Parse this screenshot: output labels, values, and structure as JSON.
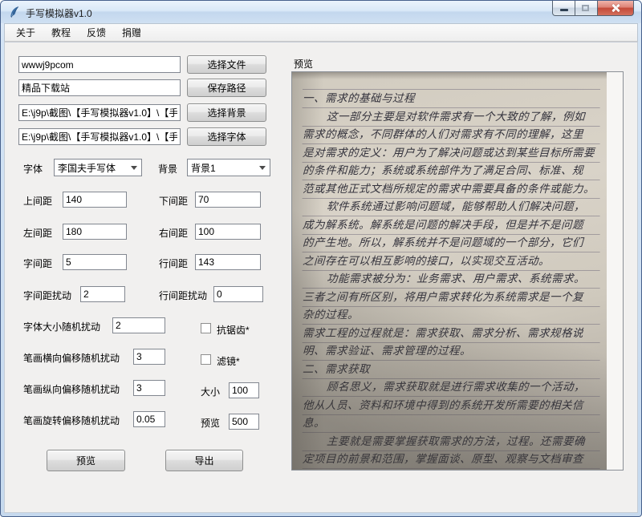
{
  "window": {
    "title": "手写模拟器v1.0"
  },
  "menu": {
    "about": "关于",
    "tutorial": "教程",
    "feedback": "反馈",
    "donate": "捐赠"
  },
  "file_section": {
    "text_value": "wwwj9pcom",
    "save_value": "精品下载站",
    "background_path": "E:\\j9p\\截图\\【手写模拟器v1.0】\\【手",
    "font_path": "E:\\j9p\\截图\\【手写模拟器v1.0】\\【手",
    "choose_file": "选择文件",
    "save_path": "保存路径",
    "choose_background": "选择背景",
    "choose_font": "选择字体"
  },
  "selectors": {
    "font_label": "字体",
    "font_value": "李国夫手写体",
    "background_label": "背景",
    "background_value": "背景1"
  },
  "spacing": {
    "top": {
      "label": "上间距",
      "value": "140"
    },
    "bottom": {
      "label": "下间距",
      "value": "70"
    },
    "left": {
      "label": "左间距",
      "value": "180"
    },
    "right": {
      "label": "右间距",
      "value": "100"
    },
    "char": {
      "label": "字间距",
      "value": "5"
    },
    "line": {
      "label": "行间距",
      "value": "143"
    },
    "char_jitter": {
      "label": "字间距扰动",
      "value": "2"
    },
    "line_jitter": {
      "label": "行间距扰动",
      "value": "0"
    }
  },
  "perturb": {
    "font_size": {
      "label": "字体大小随机扰动",
      "value": "2"
    },
    "stroke_h": {
      "label": "笔画横向偏移随机扰动",
      "value": "3"
    },
    "stroke_v": {
      "label": "笔画纵向偏移随机扰动",
      "value": "3"
    },
    "stroke_rot": {
      "label": "笔画旋转偏移随机扰动",
      "value": "0.05"
    }
  },
  "options": {
    "antialias": {
      "label": "抗锯齿*",
      "checked": false
    },
    "filter": {
      "label": "滤镜*",
      "checked": false
    },
    "size": {
      "label": "大小",
      "value": "100"
    },
    "preview_size": {
      "label": "预览",
      "value": "500"
    }
  },
  "actions": {
    "preview": "预览",
    "export": "导出"
  },
  "preview": {
    "label": "预览",
    "lines": [
      {
        "t": "一、需求的基础与过程",
        "ind": false
      },
      {
        "t": "这一部分主要是对软件需求有一个大致的了解，例如",
        "ind": true
      },
      {
        "t": "需求的概念，不同群体的人们对需求有不同的理解，这里",
        "ind": false
      },
      {
        "t": "是对需求的定义：用户为了解决问题或达到某些目标所需要",
        "ind": false
      },
      {
        "t": "的条件和能力；系统或系统部件为了满足合同、标准、规",
        "ind": false
      },
      {
        "t": "范或其他正式文档所规定的需求中需要具备的条件或能力。",
        "ind": false
      },
      {
        "t": "软件系统通过影响问题域，能够帮助人们解决问题，",
        "ind": true
      },
      {
        "t": "成为解系统。解系统是问题的解决手段，但是并不是问题",
        "ind": false
      },
      {
        "t": "的产生地。所以，解系统并不是问题域的一个部分，它们",
        "ind": false
      },
      {
        "t": "之间存在可以相互影响的接口，以实现交互活动。",
        "ind": false
      },
      {
        "t": "功能需求被分为：业务需求、用户需求、系统需求。",
        "ind": true
      },
      {
        "t": "三者之间有所区别，将用户需求转化为系统需求是一个复",
        "ind": false
      },
      {
        "t": "杂的过程。",
        "ind": false
      },
      {
        "t": "需求工程的过程就是：需求获取、需求分析、需求规格说",
        "ind": false
      },
      {
        "t": "明、需求验证、需求管理的过程。",
        "ind": false
      },
      {
        "t": "二、需求获取",
        "ind": false
      },
      {
        "t": "顾名思义，需求获取就是进行需求收集的一个活动，",
        "ind": true
      },
      {
        "t": "他从人员、资料和环境中得到的系统开发所需要的相关信",
        "ind": false
      },
      {
        "t": "息。",
        "ind": false
      },
      {
        "t": "主要就是需要掌握获取需求的方法，过程。还需要确",
        "ind": true
      },
      {
        "t": "定项目的前景和范围，掌握面谈、原型、观察与文档审查",
        "ind": false
      }
    ]
  },
  "colors": {
    "titlebar": "#d8e6f5",
    "frame": "#c6d9ee",
    "close_button": "#c44a39",
    "client_bg": "#f1f0ef",
    "paper": "#d5cfc3",
    "ink": "#34333d"
  }
}
